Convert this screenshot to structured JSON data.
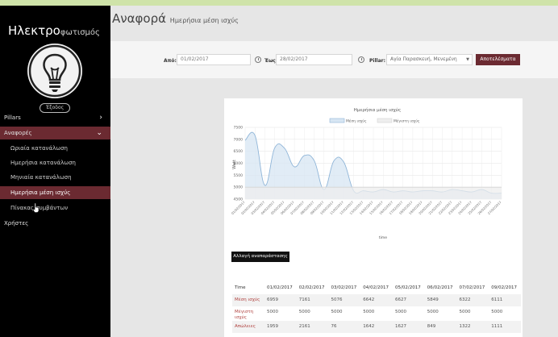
{
  "app": {
    "brand_big": "Ηλεκτρο",
    "brand_small": "φωτισμός",
    "logout": "Έξοδος"
  },
  "nav": {
    "pillars": "Pillars",
    "reports": "Αναφορές",
    "sub": [
      "Ωριαία κατανάλωση",
      "Ημερήσια κατανάλωση",
      "Μηνιαία κατανάλωση",
      "Ημερήσια μέση ισχύς",
      "Πίνακας συμβάντων"
    ],
    "users": "Χρήστες"
  },
  "page": {
    "title": "Αναφορά",
    "subtitle": "Ημερήσια μέση ισχύς"
  },
  "filter": {
    "from_label": "Από:",
    "from_value": "01/02/2017",
    "to_label": "Έως:",
    "to_value": "28/02/2017",
    "pillar_label": "Pillar:",
    "pillar_value": "Αγία Παρασκευή, Μενεμένη",
    "submit": "Αποτελέσματα"
  },
  "chart_data": {
    "type": "line",
    "title": "Ημερήσια μέση ισχύς",
    "xlabel": "time",
    "ylabel": "Watt",
    "ylim": [
      4500,
      7500
    ],
    "yticks": [
      4500,
      5000,
      5500,
      6000,
      6500,
      7000,
      7500
    ],
    "x": [
      "01/02/2017",
      "02/02/2017",
      "03/02/2017",
      "04/02/2017",
      "05/02/2017",
      "06/02/2017",
      "07/02/2017",
      "08/02/2017",
      "09/02/2017",
      "10/02/2017",
      "11/02/2017",
      "12/02/2017",
      "13/02/2017",
      "14/02/2017",
      "15/02/2017",
      "16/02/2017",
      "17/02/2017",
      "18/02/2017",
      "19/02/2017",
      "20/02/2017",
      "21/02/2017",
      "22/02/2017",
      "23/02/2017",
      "24/02/2017",
      "25/02/2017",
      "26/02/2017",
      "27/02/2017"
    ],
    "series": [
      {
        "name": "Μέση ισχύς",
        "color": "#8fb5d8",
        "fill": "#d7e6f3",
        "values": [
          6959,
          7161,
          5076,
          6642,
          6627,
          5849,
          6322,
          6111,
          4900,
          6100,
          6050,
          4850,
          4850,
          4800,
          4900,
          4800,
          4850,
          4800,
          4850,
          4850,
          4800,
          4900,
          4850,
          4800,
          4900,
          4750,
          4750
        ]
      },
      {
        "name": "Μέγιστη ισχύς",
        "color": "#d4d4d4",
        "fill": "#eeeeee",
        "values": [
          5000,
          5000,
          5000,
          5000,
          5000,
          5000,
          5000,
          5000,
          5000,
          5000,
          5000,
          5000,
          5000,
          5000,
          5000,
          5000,
          5000,
          5000,
          5000,
          5000,
          5000,
          5000,
          5000,
          5000,
          5000,
          5000,
          5000
        ]
      }
    ]
  },
  "toggle_button": "Αλλαγή αναπαράστασης",
  "table": {
    "header": [
      "Time",
      "01/02/2017",
      "02/02/2017",
      "03/02/2017",
      "04/02/2017",
      "05/02/2017",
      "06/02/2017",
      "07/02/2017",
      "09/02/2017"
    ],
    "rows": [
      {
        "label": "Μέση ισχύς",
        "values": [
          "6959",
          "7161",
          "5076",
          "6642",
          "6627",
          "5849",
          "6322",
          "6111"
        ]
      },
      {
        "label": "Μέγιστη ισχύς",
        "values": [
          "5000",
          "5000",
          "5000",
          "5000",
          "5000",
          "5000",
          "5000",
          "5000"
        ]
      },
      {
        "label": "Απώλειες",
        "values": [
          "1959",
          "2161",
          "76",
          "1642",
          "1627",
          "849",
          "1322",
          "1111"
        ]
      }
    ]
  }
}
